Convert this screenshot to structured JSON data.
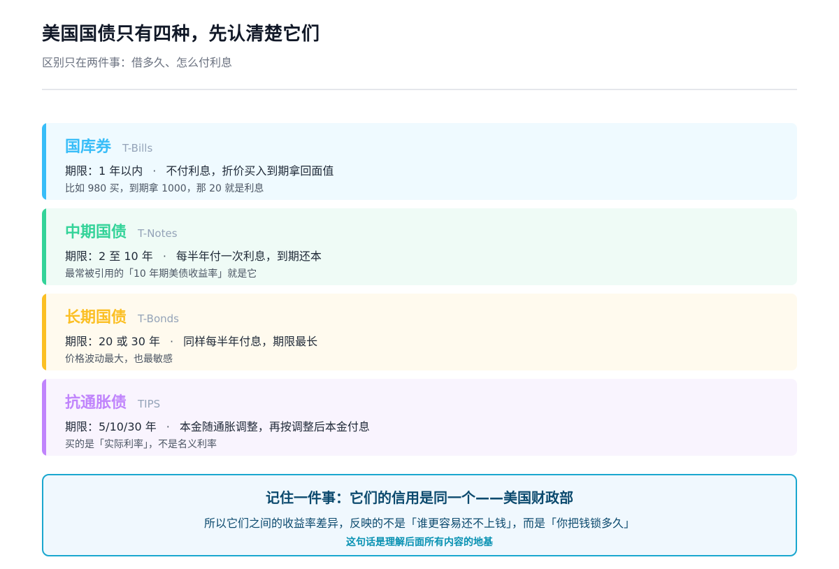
{
  "header": {
    "title": "美国国债只有四种，先认清楚它们",
    "subtitle": "区别只在两件事：借多久、怎么付利息"
  },
  "bonds": [
    {
      "name": "国库券",
      "english": "T-Bills",
      "term": "期限：1 年以内",
      "separator": "·",
      "interest": "不付利息，折价买入到期拿回面值",
      "note": "比如 980 买，到期拿 1000，那 20 就是利息",
      "accent_color": "#38bdf8",
      "bg_color": "#effaff"
    },
    {
      "name": "中期国债",
      "english": "T-Notes",
      "term": "期限：2 至 10 年",
      "separator": "·",
      "interest": "每半年付一次利息，到期还本",
      "note": "最常被引用的「10 年期美债收益率」就是它",
      "accent_color": "#34d399",
      "bg_color": "#effbf6"
    },
    {
      "name": "长期国债",
      "english": "T-Bonds",
      "term": "期限：20 或 30 年",
      "separator": "·",
      "interest": "同样每半年付息，期限最长",
      "note": "价格波动最大，也最敏感",
      "accent_color": "#fbbf24",
      "bg_color": "#fffaee"
    },
    {
      "name": "抗通胀债",
      "english": "TIPS",
      "term": "期限：5/10/30 年",
      "separator": "·",
      "interest": "本金随通胀调整，再按调整后本金付息",
      "note": "买的是「实际利率」，不是名义利率",
      "accent_color": "#c084fc",
      "bg_color": "#f9f4fe"
    }
  ],
  "summary": {
    "title": "记住一件事：它们的信用是同一个——美国财政部",
    "body": "所以它们之间的收益率差异，反映的不是「谁更容易还不上钱」，而是「你把钱锁多久」",
    "footer": "这句话是理解后面所有内容的地基",
    "border_color": "#1aa7cf"
  }
}
